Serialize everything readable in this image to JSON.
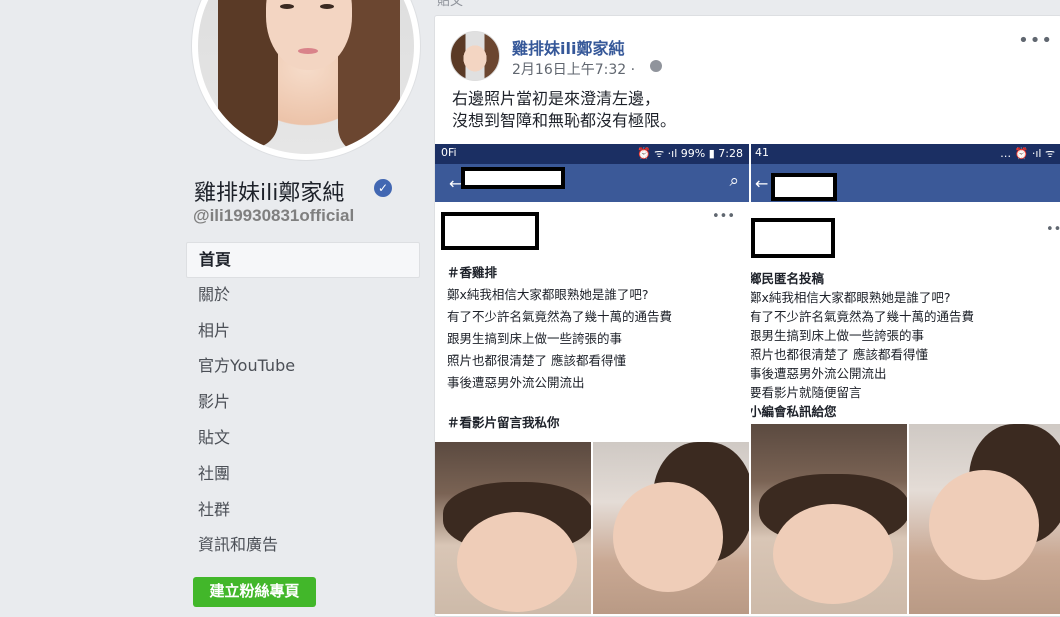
{
  "profile": {
    "name": "雞排妹ili鄭家純",
    "verified_badge": "✓",
    "handle": "@ili19930831official"
  },
  "nav": {
    "items": [
      {
        "label": "首頁"
      },
      {
        "label": "關於"
      },
      {
        "label": "相片"
      },
      {
        "label": "官方YouTube"
      },
      {
        "label": "影片"
      },
      {
        "label": "貼文"
      },
      {
        "label": "社團"
      },
      {
        "label": "社群"
      },
      {
        "label": "資訊和廣告"
      }
    ],
    "create_button": "建立粉絲專頁"
  },
  "post": {
    "top_label": "貼文",
    "author": "雞排妹ili鄭家純",
    "timestamp": "2月16日上午7:32 ·",
    "menu": "•••",
    "text": "右邊照片當初是來澄清左邊，\n沒想到智障和無恥都沒有極限。"
  },
  "left_shot": {
    "status_left": "0Fi",
    "status_right": "⏰ ᯤ ·ıl 99% ▮ 7:28",
    "search_icon": "⌕",
    "menu": "•••",
    "lines": [
      {
        "text": "＃香雞排",
        "bold": true
      },
      {
        "text": "鄭x純我相信大家都眼熟她是誰了吧?",
        "bold": false
      },
      {
        "text": "有了不少許名氣竟然為了幾十萬的通告費",
        "bold": false
      },
      {
        "text": "跟男生搞到床上做一些誇張的事",
        "bold": false
      },
      {
        "text": "照片也都很清楚了 應該都看得懂",
        "bold": false
      },
      {
        "text": "事後遭惡男外流公開流出",
        "bold": false
      },
      {
        "text": "＃看影片留言我私你",
        "bold": true
      }
    ]
  },
  "right_shot": {
    "status_left": "41",
    "status_right": "… ⏰ ·ıl ᯤ",
    "menu": "•••",
    "lines": [
      {
        "text": "鄉民匿名投稿",
        "bold": true
      },
      {
        "text": "鄭x純我相信大家都眼熟她是誰了吧?",
        "bold": false
      },
      {
        "text": "有了不少許名氣竟然為了幾十萬的通告費",
        "bold": false
      },
      {
        "text": "跟男生搞到床上做一些誇張的事",
        "bold": false
      },
      {
        "text": "照片也都很清楚了 應該都看得懂",
        "bold": false
      },
      {
        "text": "事後遭惡男外流公開流出",
        "bold": false
      },
      {
        "text": "要看影片就隨便留言",
        "bold": false
      },
      {
        "text": "小編會私訊給您",
        "bold": true
      }
    ]
  },
  "colors": {
    "link": "#365899",
    "fb_blue": "#3b5998",
    "status_bar": "#1b2f63",
    "create_green": "#42b72a",
    "page_bg": "#e9ebee"
  }
}
